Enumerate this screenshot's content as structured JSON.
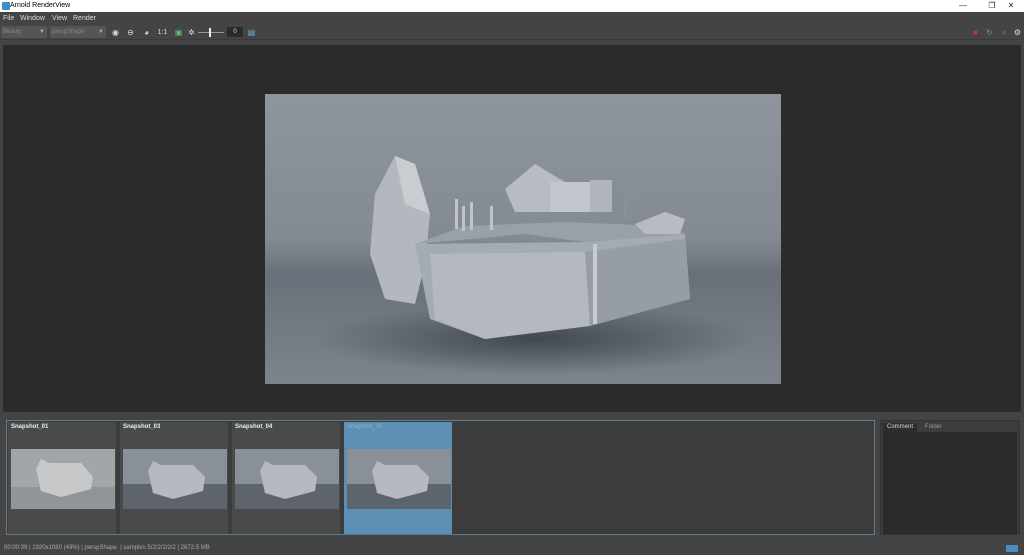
{
  "window": {
    "title": "Arnold RenderView",
    "minimize": "—",
    "maximize": "❐",
    "close": "✕"
  },
  "menu": [
    "File",
    "Window",
    "View",
    "Render"
  ],
  "toolbar": {
    "aov_dropdown": "Beauty",
    "camera_dropdown": "perspShape",
    "ratio_label": "1:1",
    "exposure_value": "0"
  },
  "snapshots": [
    {
      "label": "Snapshot_01",
      "selected": false
    },
    {
      "label": "Snapshot_03",
      "selected": false
    },
    {
      "label": "Snapshot_04",
      "selected": false
    },
    {
      "label": "Snapshot_05",
      "selected": true
    }
  ],
  "side_panel": {
    "tabs": [
      "Comment",
      "Folder"
    ],
    "active_tab": "Comment"
  },
  "status": {
    "text": "00:00:39 | 1920x1080 (49%) | perspShape  | samples 5/2/2/2/2/2 | 2672.5 MB"
  },
  "colors": {
    "accent": "#5b8fb3",
    "render_stop": "#c0392b"
  }
}
